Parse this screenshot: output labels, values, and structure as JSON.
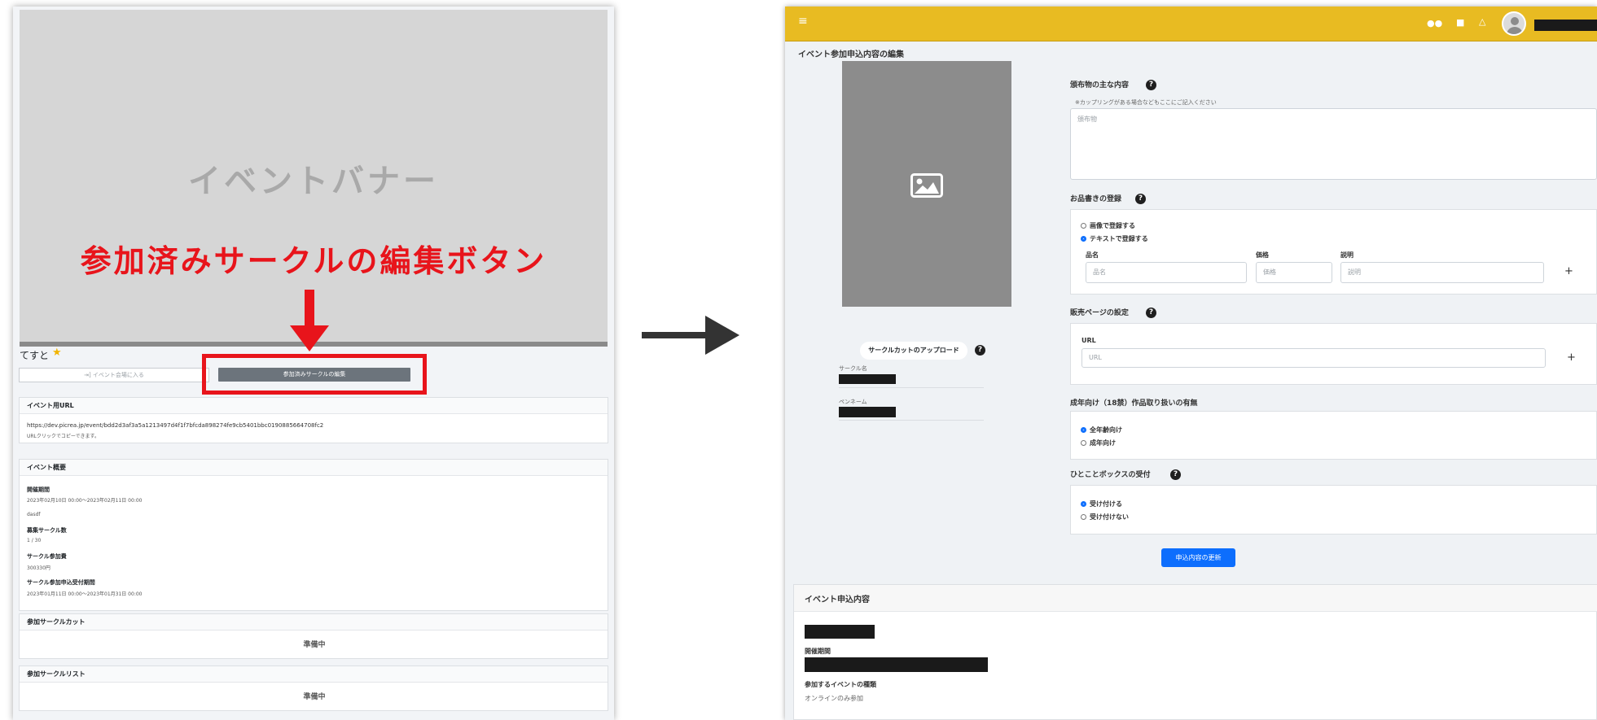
{
  "left": {
    "banner_text": "イベントバナー",
    "callout_text": "参加済みサークルの編集ボタン",
    "event_name": "てすと",
    "star": "★",
    "enter_button": "⇥] イベント会場に入る",
    "edit_circle_button": "参加済みサークルの編集",
    "url_card": {
      "title": "イベント用URL",
      "url": "https://dev.picrea.jp/event/bdd2d3af3a5a1213497d4f1f7bfcda898274fe9cb5401bbc0190885664708fc2",
      "hint": "URLクリックでコピーできます。"
    },
    "summary_card": {
      "title": "イベント概要",
      "period_label": "開催期間",
      "period_value": "2023年02月10日 00:00〜2023年02月11日 00:00",
      "description": "dasdf",
      "recruit_label": "募集サークル数",
      "recruit_value": "1 / 30",
      "fee_label": "サークル参加費",
      "fee_value": "300330円",
      "apply_label": "サークル参加申込受付期間",
      "apply_value": "2023年01月11日 00:00〜2023年01月31日 00:00"
    },
    "cut_card": {
      "title": "参加サークルカット",
      "body": "準備中"
    },
    "list_card": {
      "title": "参加サークルリスト",
      "body": "準備中"
    }
  },
  "right": {
    "page_title": "イベント参加申込内容の編集",
    "upload_button": "サークルカットのアップロード",
    "circle_name_label": "サークル名",
    "pen_name_label": "ペンネーム",
    "distribution": {
      "title": "頒布物の主な内容",
      "note": "※カップリングがある場合などもここにご記入ください",
      "placeholder": "頒布物"
    },
    "menu_register": {
      "title": "お品書きの登録",
      "option_image": "画像で登録する",
      "option_text": "テキストで登録する",
      "col_name": "品名",
      "col_price": "価格",
      "col_desc": "説明",
      "ph_name": "品名",
      "ph_price": "価格",
      "ph_desc": "説明",
      "plus": "+"
    },
    "sales_page": {
      "title": "販売ページの設定",
      "url_label": "URL",
      "url_placeholder": "URL",
      "plus": "+"
    },
    "adult": {
      "title": "成年向け（18禁）作品取り扱いの有無",
      "option_all": "全年齢向け",
      "option_adult": "成年向け"
    },
    "message_box": {
      "title": "ひとことボックスの受付",
      "option_accept": "受け付ける",
      "option_reject": "受け付けない"
    },
    "update_button": "申込内容の更新",
    "application": {
      "title": "イベント申込内容",
      "period_label": "開催期間",
      "type_label": "参加するイベントの種類",
      "type_value": "オンラインのみ参加"
    },
    "help_mark": "?",
    "menu_icon": "≡"
  }
}
